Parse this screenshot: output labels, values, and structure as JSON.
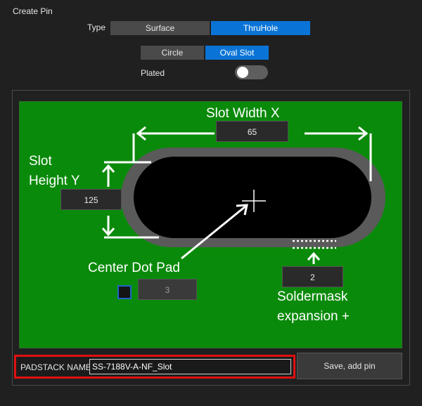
{
  "window": {
    "title": "Create Pin"
  },
  "type_selector": {
    "label": "Type",
    "options": [
      "Surface",
      "ThruHole"
    ],
    "selected": "ThruHole"
  },
  "shape_selector": {
    "options": [
      "Circle",
      "Oval Slot"
    ],
    "selected": "Oval Slot"
  },
  "plated": {
    "label": "Plated",
    "on": false
  },
  "diagram": {
    "slot_width_label": "Slot Width X",
    "slot_width_value": "65",
    "slot_height_label_line1": "Slot",
    "slot_height_label_line2": "Height Y",
    "slot_height_value": "125",
    "center_dot_label": "Center Dot Pad",
    "center_dot_value": "3",
    "soldermask_label_line1": "Soldermask",
    "soldermask_label_line2": "expansion +",
    "soldermask_value": "2",
    "colors": {
      "board": "#0a8a0a",
      "ring": "#5a5a5a",
      "pad": "#000000",
      "annotation": "#ffffff"
    }
  },
  "padstack": {
    "label": "PADSTACK NAME",
    "value": "SS-7188V-A-NF_Slot"
  },
  "save_button": {
    "label": "Save, add pin"
  }
}
